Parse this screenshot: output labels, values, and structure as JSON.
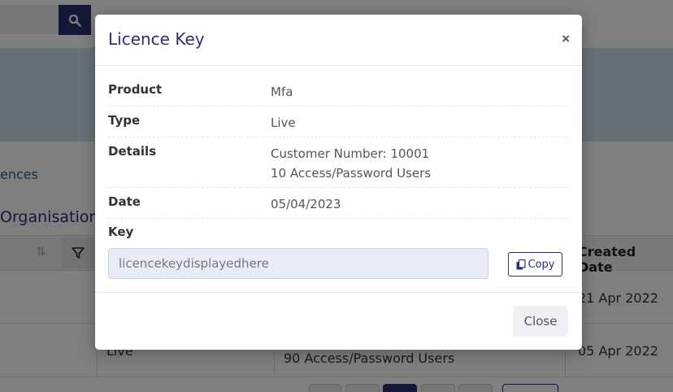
{
  "background": {
    "breadcrumb_fragment": "ences",
    "section_title_fragment": "Organisation",
    "column_header": "Created Date",
    "rows": [
      {
        "date": "21 Apr 2022"
      },
      {
        "type": "Live",
        "users": "90 Access/Password Users",
        "date": "05 Apr 2022"
      }
    ],
    "icons": {
      "search": "search-icon",
      "sort": "sort-icon",
      "filter": "filter-icon"
    }
  },
  "modal": {
    "title": "Licence Key",
    "close_symbol": "×",
    "details": [
      {
        "label": "Product",
        "value": "Mfa"
      },
      {
        "label": "Type",
        "value": "Live"
      },
      {
        "label": "Details",
        "lines": [
          "Customer Number: 10001",
          "10 Access/Password Users"
        ]
      },
      {
        "label": "Date",
        "value": "05/04/2023"
      }
    ],
    "key_label": "Key",
    "key_value": "licencekeydisplayedhere",
    "copy_label": "Copy",
    "copy_icon": "copy-icon",
    "close_label": "Close"
  },
  "colors": {
    "brand": "#2b2f73",
    "banner": "#cfe3ea",
    "input_bg": "#e8ecf4"
  }
}
